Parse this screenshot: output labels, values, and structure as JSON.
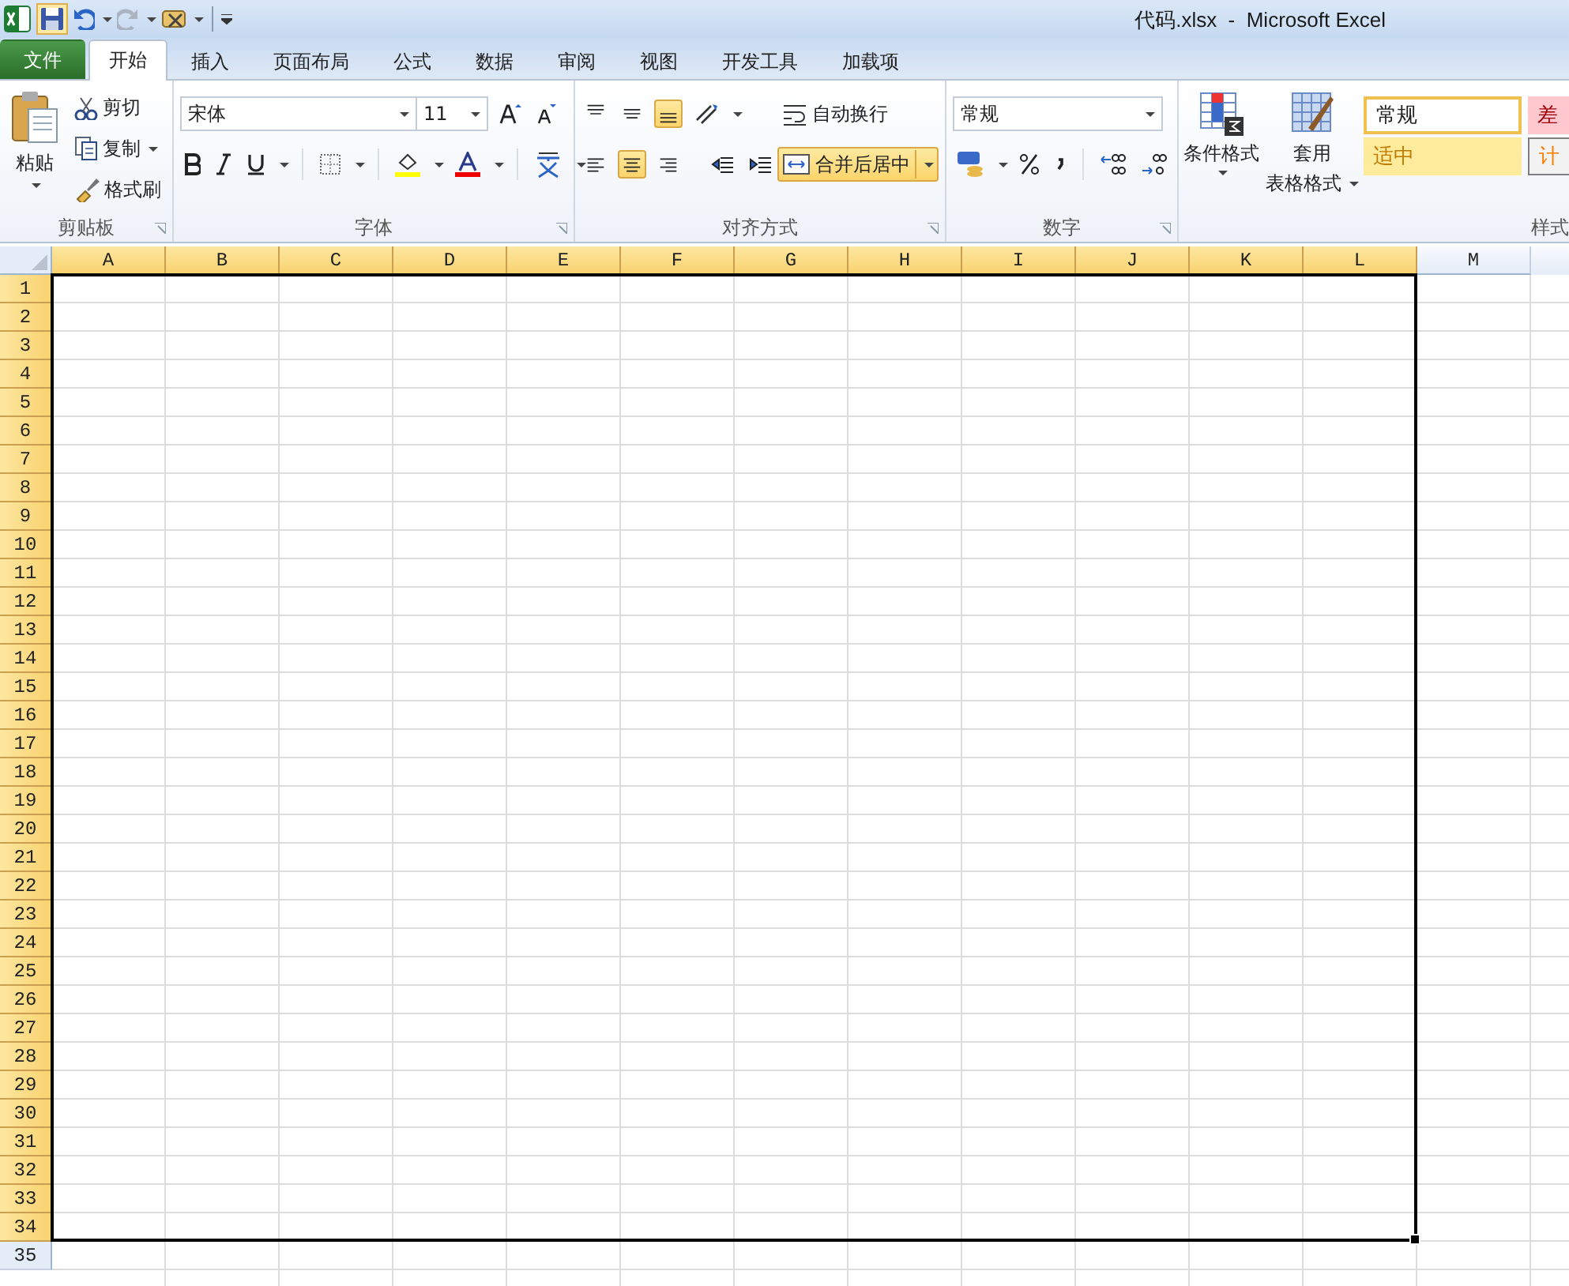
{
  "window": {
    "title": "代码.xlsx  -  Microsoft Excel"
  },
  "tabs": [
    {
      "label": "文件",
      "kind": "file",
      "selected": false
    },
    {
      "label": "开始",
      "kind": "tab",
      "selected": true
    },
    {
      "label": "插入",
      "kind": "tab",
      "selected": false
    },
    {
      "label": "页面布局",
      "kind": "tab",
      "selected": false
    },
    {
      "label": "公式",
      "kind": "tab",
      "selected": false
    },
    {
      "label": "数据",
      "kind": "tab",
      "selected": false
    },
    {
      "label": "审阅",
      "kind": "tab",
      "selected": false
    },
    {
      "label": "视图",
      "kind": "tab",
      "selected": false
    },
    {
      "label": "开发工具",
      "kind": "tab",
      "selected": false
    },
    {
      "label": "加载项",
      "kind": "tab",
      "selected": false
    }
  ],
  "ribbon": {
    "clipboard": {
      "label": "剪贴板",
      "paste": "粘贴",
      "cut": "剪切",
      "copy": "复制",
      "format_painter": "格式刷"
    },
    "font": {
      "label": "字体",
      "font_name": "宋体",
      "font_size": "11"
    },
    "alignment": {
      "label": "对齐方式",
      "vertical": [
        {
          "selected": false
        },
        {
          "selected": false
        },
        {
          "selected": true
        }
      ],
      "horizontal": [
        {
          "selected": false
        },
        {
          "selected": true
        },
        {
          "selected": false
        }
      ],
      "wrap_text": {
        "label": "自动换行",
        "selected": false
      },
      "merge_center": {
        "label": "合并后居中",
        "selected": true
      }
    },
    "number": {
      "label": "数字",
      "format": "常规"
    },
    "styles": {
      "label": "样式",
      "conditional": "条件格式",
      "table_format_1": "套用",
      "table_format_2": "表格格式",
      "cell_styles": [
        {
          "label": "常规",
          "kind": "normal"
        },
        {
          "label": "差",
          "kind": "bad"
        },
        {
          "label": "适中",
          "kind": "neutral"
        },
        {
          "label": "计",
          "kind": "calc"
        }
      ]
    }
  },
  "grid": {
    "columns": [
      {
        "label": "A",
        "selected": true
      },
      {
        "label": "B",
        "selected": true
      },
      {
        "label": "C",
        "selected": true
      },
      {
        "label": "D",
        "selected": true
      },
      {
        "label": "E",
        "selected": true
      },
      {
        "label": "F",
        "selected": true
      },
      {
        "label": "G",
        "selected": true
      },
      {
        "label": "H",
        "selected": true
      },
      {
        "label": "I",
        "selected": true
      },
      {
        "label": "J",
        "selected": true
      },
      {
        "label": "K",
        "selected": true
      },
      {
        "label": "L",
        "selected": true
      },
      {
        "label": "M",
        "selected": false
      }
    ],
    "rows": [
      {
        "label": "1",
        "selected": true
      },
      {
        "label": "2",
        "selected": true
      },
      {
        "label": "3",
        "selected": true
      },
      {
        "label": "4",
        "selected": true
      },
      {
        "label": "5",
        "selected": true
      },
      {
        "label": "6",
        "selected": true
      },
      {
        "label": "7",
        "selected": true
      },
      {
        "label": "8",
        "selected": true
      },
      {
        "label": "9",
        "selected": true
      },
      {
        "label": "10",
        "selected": true
      },
      {
        "label": "11",
        "selected": true
      },
      {
        "label": "12",
        "selected": true
      },
      {
        "label": "13",
        "selected": true
      },
      {
        "label": "14",
        "selected": true
      },
      {
        "label": "15",
        "selected": true
      },
      {
        "label": "16",
        "selected": true
      },
      {
        "label": "17",
        "selected": true
      },
      {
        "label": "18",
        "selected": true
      },
      {
        "label": "19",
        "selected": true
      },
      {
        "label": "20",
        "selected": true
      },
      {
        "label": "21",
        "selected": true
      },
      {
        "label": "22",
        "selected": true
      },
      {
        "label": "23",
        "selected": true
      },
      {
        "label": "24",
        "selected": true
      },
      {
        "label": "25",
        "selected": true
      },
      {
        "label": "26",
        "selected": true
      },
      {
        "label": "27",
        "selected": true
      },
      {
        "label": "28",
        "selected": true
      },
      {
        "label": "29",
        "selected": true
      },
      {
        "label": "30",
        "selected": true
      },
      {
        "label": "31",
        "selected": true
      },
      {
        "label": "32",
        "selected": true
      },
      {
        "label": "33",
        "selected": true
      },
      {
        "label": "34",
        "selected": true
      },
      {
        "label": "35",
        "selected": false
      }
    ]
  }
}
